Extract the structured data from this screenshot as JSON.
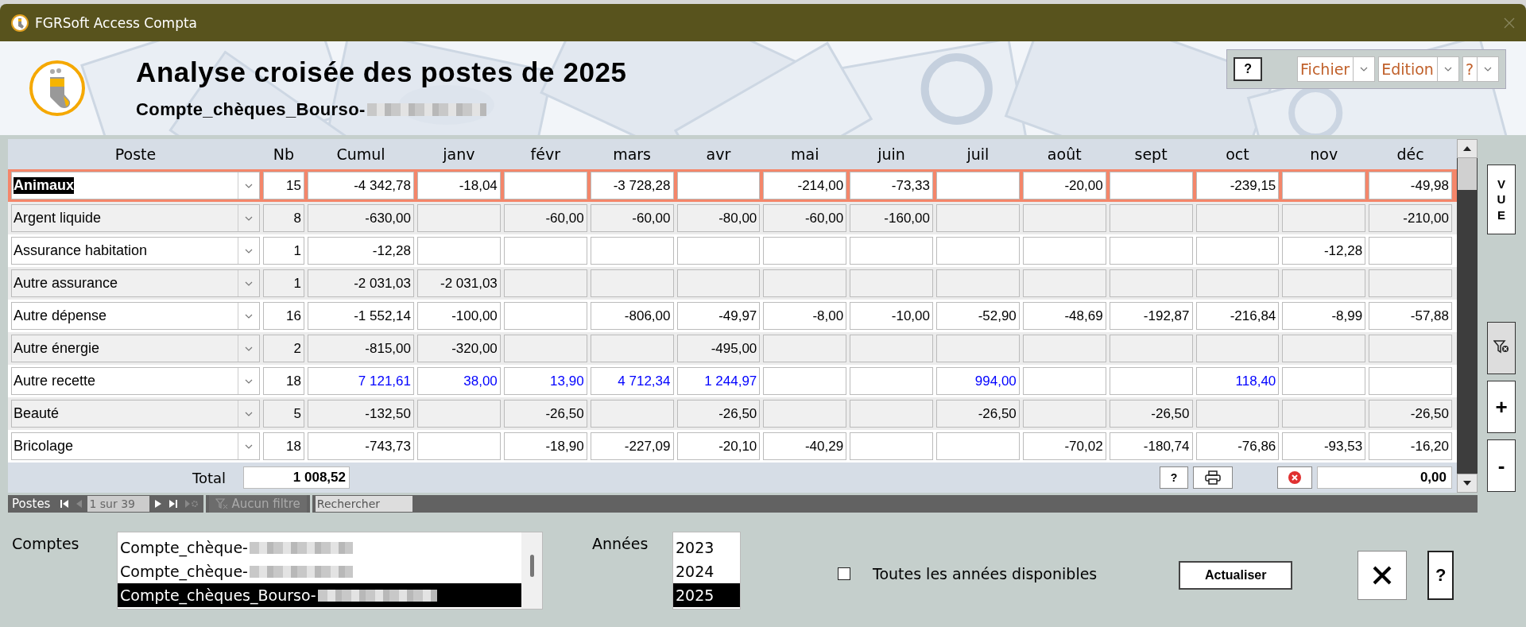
{
  "window": {
    "title": "FGRSoft Access Compta"
  },
  "header": {
    "title": "Analyse croisée des postes de 2025",
    "subtitle": "Compte_chèques_Bourso-"
  },
  "toolbar": {
    "help_button": "?",
    "menus": [
      "Fichier",
      "Edition",
      "?"
    ]
  },
  "table": {
    "columns": [
      "Poste",
      "Nb",
      "Cumul",
      "janv",
      "févr",
      "mars",
      "avr",
      "mai",
      "juin",
      "juil",
      "août",
      "sept",
      "oct",
      "nov",
      "déc"
    ],
    "rows": [
      {
        "selected": true,
        "color": "#000000",
        "cells": [
          "Animaux",
          "15",
          "-4 342,78",
          "-18,04",
          "",
          "-3 728,28",
          "",
          "-214,00",
          "-73,33",
          "",
          "-20,00",
          "",
          "-239,15",
          "",
          "-49,98"
        ]
      },
      {
        "selected": false,
        "color": "#000000",
        "cells": [
          "Argent liquide",
          "8",
          "-630,00",
          "",
          "-60,00",
          "-60,00",
          "-80,00",
          "-60,00",
          "-160,00",
          "",
          "",
          "",
          "",
          "",
          "-210,00"
        ]
      },
      {
        "selected": false,
        "color": "#000000",
        "cells": [
          "Assurance habitation",
          "1",
          "-12,28",
          "",
          "",
          "",
          "",
          "",
          "",
          "",
          "",
          "",
          "",
          "-12,28",
          ""
        ]
      },
      {
        "selected": false,
        "color": "#000000",
        "cells": [
          "Autre assurance",
          "1",
          "-2 031,03",
          "-2 031,03",
          "",
          "",
          "",
          "",
          "",
          "",
          "",
          "",
          "",
          "",
          ""
        ]
      },
      {
        "selected": false,
        "color": "#000000",
        "cells": [
          "Autre dépense",
          "16",
          "-1 552,14",
          "-100,00",
          "",
          "-806,00",
          "-49,97",
          "-8,00",
          "-10,00",
          "-52,90",
          "-48,69",
          "-192,87",
          "-216,84",
          "-8,99",
          "-57,88"
        ]
      },
      {
        "selected": false,
        "color": "#000000",
        "cells": [
          "Autre énergie",
          "2",
          "-815,00",
          "-320,00",
          "",
          "",
          "-495,00",
          "",
          "",
          "",
          "",
          "",
          "",
          "",
          ""
        ]
      },
      {
        "selected": false,
        "color": "#0000ff",
        "cells": [
          "Autre recette",
          "18",
          "7 121,61",
          "38,00",
          "13,90",
          "4 712,34",
          "1 244,97",
          "",
          "",
          "994,00",
          "",
          "",
          "118,40",
          "",
          ""
        ]
      },
      {
        "selected": false,
        "color": "#000000",
        "cells": [
          "Beauté",
          "5",
          "-132,50",
          "",
          "-26,50",
          "",
          "-26,50",
          "",
          "",
          "-26,50",
          "",
          "-26,50",
          "",
          "",
          "-26,50"
        ]
      },
      {
        "selected": false,
        "color": "#000000",
        "cells": [
          "Bricolage",
          "18",
          "-743,73",
          "",
          "-18,90",
          "-227,09",
          "-20,10",
          "-40,29",
          "",
          "",
          "-70,02",
          "-180,74",
          "-76,86",
          "-93,53",
          "-16,20"
        ]
      }
    ],
    "total": {
      "label": "Total",
      "value": "1 008,52"
    },
    "footer": {
      "help_button": "?",
      "sum_value": "0,00"
    }
  },
  "navigation": {
    "label": "Postes",
    "position": "1 sur 39",
    "filter": "Aucun filtre",
    "search_placeholder": "Rechercher"
  },
  "side_buttons": {
    "view": "VUE",
    "plus": "+",
    "minus": "-"
  },
  "accounts": {
    "label": "Comptes",
    "items": [
      {
        "name": "Compte_chèque-",
        "selected": false
      },
      {
        "name": "Compte_chèque-",
        "selected": false
      },
      {
        "name": "Compte_chèques_Bourso-",
        "selected": true
      }
    ]
  },
  "years": {
    "label": "Années",
    "items": [
      {
        "name": "2023",
        "selected": false
      },
      {
        "name": "2024",
        "selected": false
      },
      {
        "name": "2025",
        "selected": true
      }
    ]
  },
  "all_years": {
    "label": "Toutes les années disponibles",
    "checked": false
  },
  "refresh_button": "Actualiser",
  "help_button": "?"
}
